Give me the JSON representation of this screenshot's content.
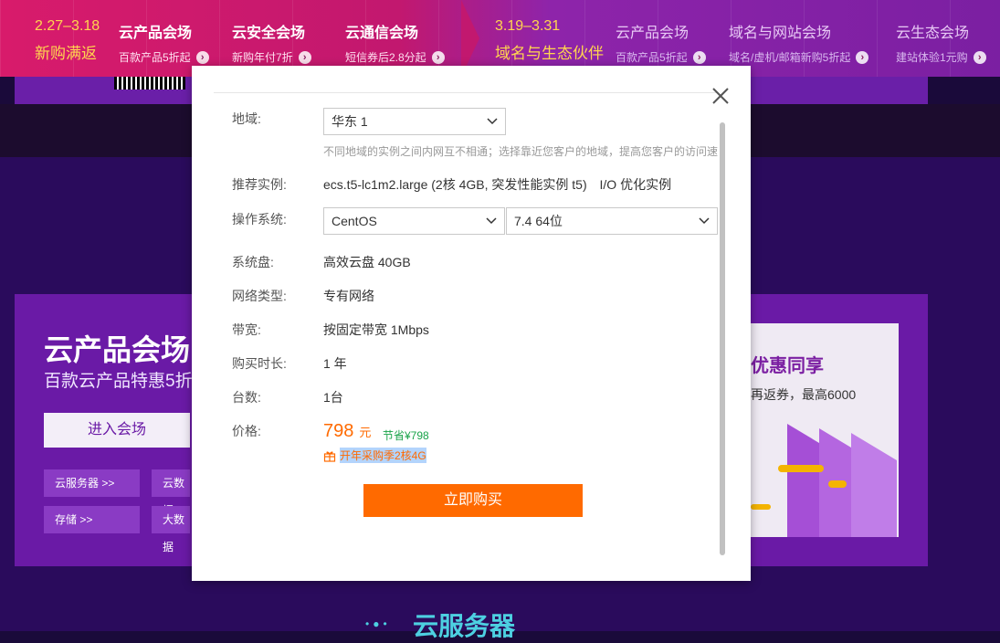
{
  "topnav": {
    "period1": {
      "dates": "2.27–3.18",
      "slogan": "新购满返"
    },
    "period2": {
      "dates": "3.19–3.31",
      "slogan": "域名与生态伙伴"
    },
    "items": [
      {
        "title": "云产品会场",
        "sub": "百款产品5折起"
      },
      {
        "title": "云安全会场",
        "sub": "新购年付7折"
      },
      {
        "title": "云通信会场",
        "sub": "短信券后2.8分起"
      },
      {
        "title": "云产品会场",
        "sub": "百款产品5折起"
      },
      {
        "title": "域名与网站会场",
        "sub": "域名/虚机/邮箱新购5折起"
      },
      {
        "title": "云生态会场",
        "sub": "建站体验1元购"
      }
    ]
  },
  "banner": {
    "title": "云产品会场",
    "subtitle": "百款云产品特惠5折",
    "enter_label": "进入会场",
    "categories": [
      "云服务器 >>",
      "云数据",
      "存储 >>",
      "大数据"
    ],
    "promo_title": "优惠同享",
    "promo_text": "再返券，最高6000"
  },
  "bottom": {
    "title": "云服务器"
  },
  "modal": {
    "region": {
      "label": "地域:",
      "value": "华东 1",
      "hint": "不同地域的实例之间内网互不相通；选择靠近您客户的地域，提高您客户的访问速"
    },
    "instance": {
      "label": "推荐实例:",
      "value": "ecs.t5-lc1m2.large (2核 4GB, 突发性能实例 t5)",
      "io": "I/O 优化实例"
    },
    "os": {
      "label": "操作系统:",
      "value": "CentOS",
      "version": "7.4 64位"
    },
    "disk": {
      "label": "系统盘:",
      "value": "高效云盘 40GB"
    },
    "network": {
      "label": "网络类型:",
      "value": "专有网络"
    },
    "bandwidth": {
      "label": "带宽:",
      "value": "按固定带宽 1Mbps"
    },
    "duration": {
      "label": "购买时长:",
      "value": "1 年"
    },
    "quantity": {
      "label": "台数:",
      "value": "1台"
    },
    "price": {
      "label": "价格:",
      "amount": "798",
      "unit": "元",
      "saved": "节省¥798",
      "gift": "开年采购季2核4G"
    },
    "buy_label": "立即购买"
  },
  "colors": {
    "accent": "#ff6a00",
    "saved": "#1aa34a",
    "nav_gold": "#ffd54f"
  }
}
